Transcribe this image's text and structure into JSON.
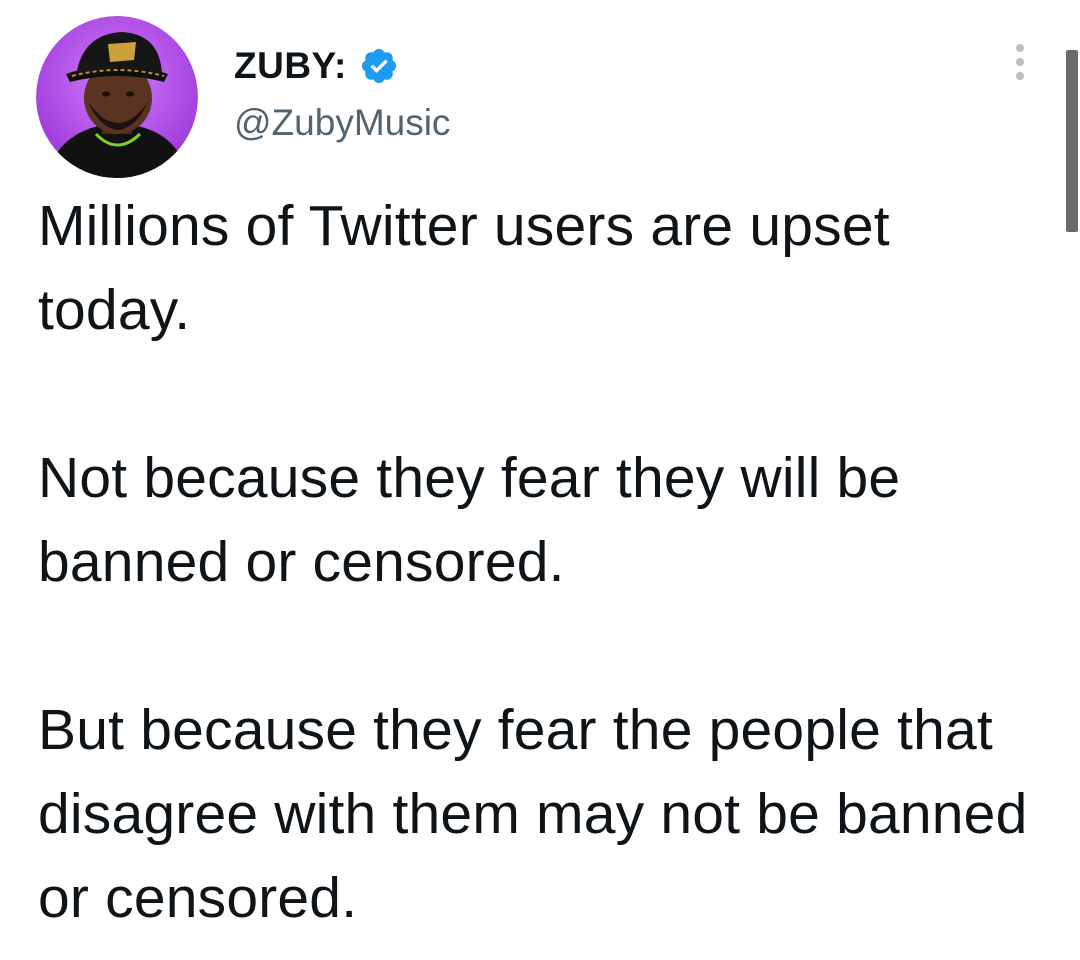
{
  "author": {
    "display_name": "ZUBY:",
    "handle": "@ZubyMusic",
    "verified": true,
    "avatar_icon": "profile-photo",
    "avatar_background": "#b64bf0"
  },
  "tweet": {
    "paragraphs": [
      "Millions of Twitter users are upset today.",
      "Not because they fear they will be banned or censored.",
      "But because they fear the people that disagree with them may not be banned or censored."
    ]
  },
  "icons": {
    "verified": "verified-badge-icon",
    "more": "more-vertical-icon"
  },
  "colors": {
    "verified_blue": "#1d9bf0",
    "handle_gray": "#536471",
    "text": "#0f1419"
  }
}
